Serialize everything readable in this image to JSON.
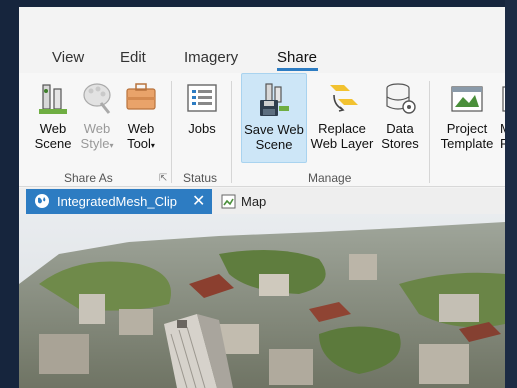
{
  "ribbon_tabs": [
    {
      "label": "View"
    },
    {
      "label": "Edit"
    },
    {
      "label": "Imagery"
    },
    {
      "label": "Share",
      "active": true
    }
  ],
  "groups": {
    "share_as": {
      "label": "Share As",
      "buttons": [
        {
          "line1": "Web",
          "line2": "Scene",
          "icon": "web-scene-icon"
        },
        {
          "line1": "Web",
          "line2": "Style",
          "icon": "web-style-icon",
          "disabled": true
        },
        {
          "line1": "Web",
          "line2": "Tool",
          "icon": "web-tool-icon"
        }
      ]
    },
    "status": {
      "label": "Status",
      "buttons": [
        {
          "line1": "Jobs",
          "line2": "",
          "icon": "jobs-icon"
        }
      ]
    },
    "manage": {
      "label": "Manage",
      "buttons": [
        {
          "line1": "Save Web",
          "line2": "Scene",
          "icon": "save-web-scene-icon",
          "selected": true
        },
        {
          "line1": "Replace",
          "line2": "Web Layer",
          "icon": "replace-web-layer-icon"
        },
        {
          "line1": "Data",
          "line2": "Stores",
          "icon": "data-stores-icon"
        }
      ]
    },
    "next": {
      "buttons": [
        {
          "line1": "Project",
          "line2": "Template",
          "icon": "project-template-icon"
        },
        {
          "line1": "M",
          "line2": "F",
          "icon": "partial-icon"
        }
      ]
    }
  },
  "document_tabs": [
    {
      "label": "IntegratedMesh_Clip",
      "active": true,
      "icon": "globe-icon"
    },
    {
      "label": "Map",
      "active": false,
      "icon": "map-icon"
    }
  ],
  "colors": {
    "accent": "#2d7cc2",
    "selected_bg": "#cde6f7"
  }
}
